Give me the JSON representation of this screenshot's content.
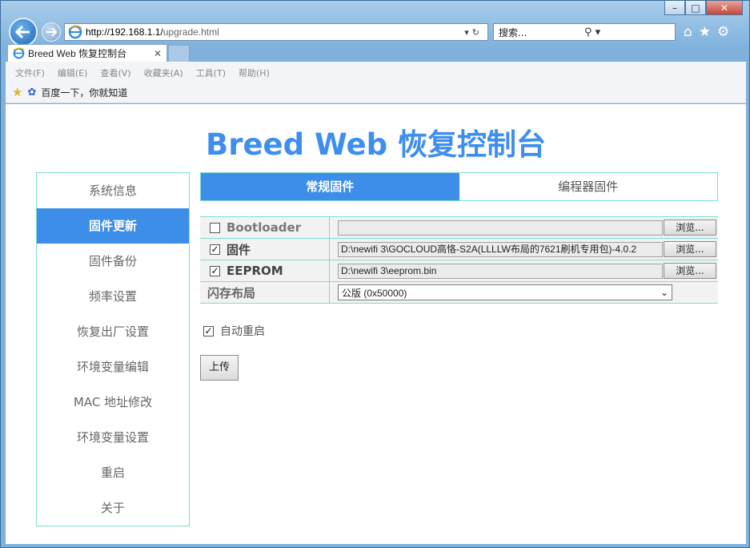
{
  "browser": {
    "url_host": "http://192.168.1.1/",
    "url_path": "upgrade.html",
    "search_placeholder": "搜索...",
    "tab_title": "Breed Web 恢复控制台",
    "menu": [
      "文件(F)",
      "编辑(E)",
      "查看(V)",
      "收藏夹(A)",
      "工具(T)",
      "帮助(H)"
    ],
    "favorite": "百度一下，你就知道"
  },
  "page": {
    "title": "Breed Web 恢复控制台",
    "sidebar": [
      "系统信息",
      "固件更新",
      "固件备份",
      "频率设置",
      "恢复出厂设置",
      "环境变量编辑",
      "MAC 地址修改",
      "环境变量设置",
      "重启",
      "关于"
    ],
    "tabs": [
      "常规固件",
      "编程器固件"
    ],
    "rows": {
      "bootloader": {
        "label": "Bootloader",
        "checked": false,
        "file": ""
      },
      "firmware": {
        "label": "固件",
        "checked": true,
        "file": "D:\\newifi 3\\GOCLOUD高恪-S2A(LLLLW布局的7621刷机专用包)-4.0.2"
      },
      "eeprom": {
        "label": "EEPROM",
        "checked": true,
        "file": "D:\\newifi 3\\eeprom.bin"
      }
    },
    "browse_label": "浏览...",
    "flash_layout_label": "闪存布局",
    "flash_layout_value": "公版 (0x50000)",
    "auto_reboot_label": "自动重启",
    "upload_label": "上传"
  }
}
